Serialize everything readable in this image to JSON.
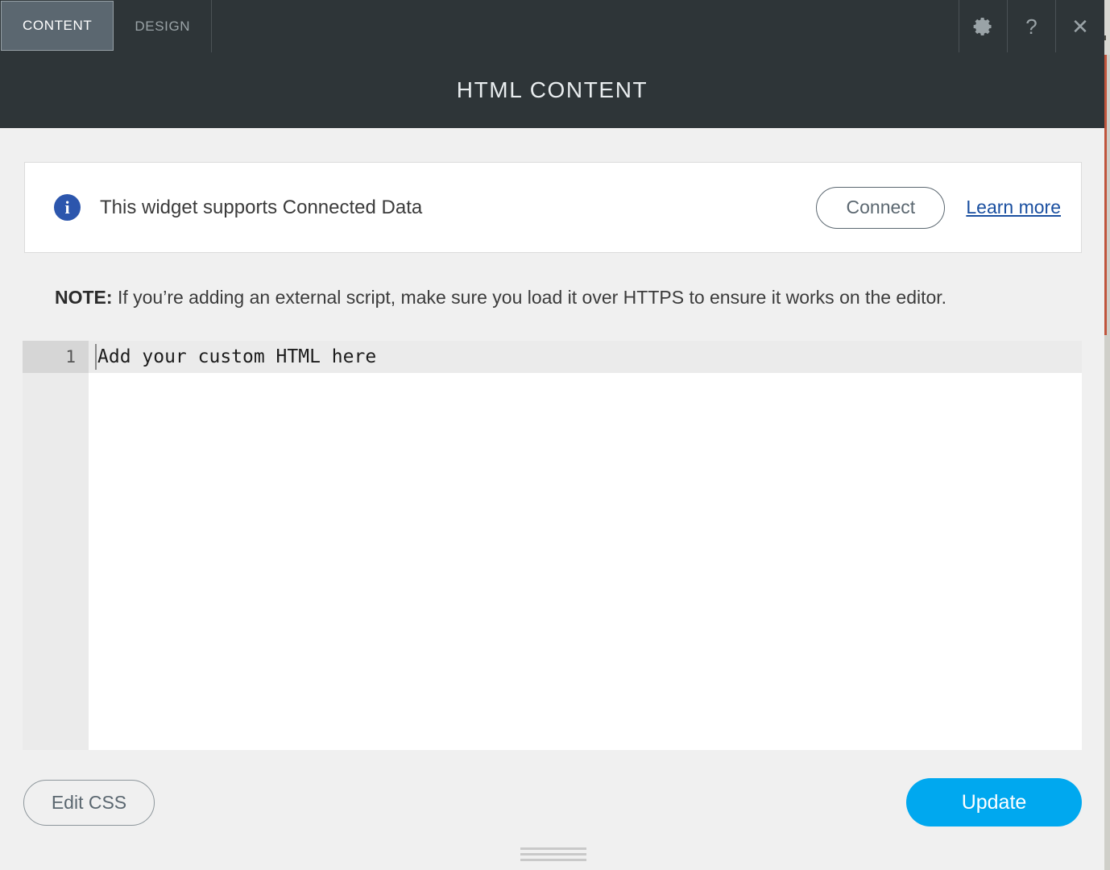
{
  "tabs": [
    {
      "label": "CONTENT",
      "active": true
    },
    {
      "label": "DESIGN",
      "active": false
    }
  ],
  "titlebar_icons": [
    {
      "name": "gear-icon",
      "glyph": "settings"
    },
    {
      "name": "help-icon",
      "glyph": "?"
    },
    {
      "name": "close-icon",
      "glyph": "✕"
    }
  ],
  "header": {
    "title": "HTML CONTENT"
  },
  "notice": {
    "icon": "info-icon",
    "text": "This widget supports Connected Data",
    "connect_label": "Connect",
    "learn_more_label": "Learn more"
  },
  "note": {
    "label": "NOTE:",
    "text": " If you’re adding an external script, make sure you load it over HTTPS to ensure it works on the editor."
  },
  "editor": {
    "line_numbers": [
      "1"
    ],
    "placeholder": "Add your custom HTML here",
    "value": ""
  },
  "footer": {
    "edit_css_label": "Edit CSS",
    "update_label": "Update"
  },
  "colors": {
    "header_bg": "#2e3538",
    "active_tab_bg": "#5b6770",
    "accent_blue": "#00a8ef",
    "link_blue": "#1a4fa0",
    "info_blue": "#2c56ad",
    "page_accent": "#c0553d"
  }
}
